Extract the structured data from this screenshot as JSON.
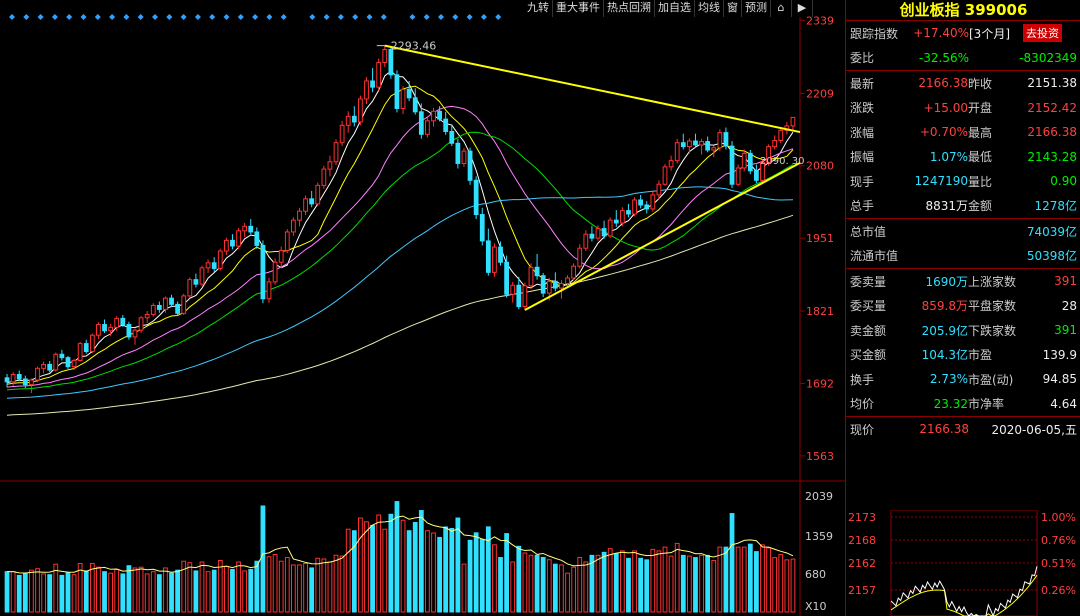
{
  "toolbar": [
    "九转",
    "重大事件",
    "热点回溯",
    "加自选",
    "均线",
    "窗",
    "预测"
  ],
  "toolbar_icons": [
    "lock-icon",
    "arrow-right-icon"
  ],
  "chart_data": {
    "type": "candlestick",
    "ohlc": [
      [
        1702,
        1709,
        1685,
        1695
      ],
      [
        1695,
        1712,
        1688,
        1708
      ],
      [
        1708,
        1715,
        1696,
        1700
      ],
      [
        1700,
        1706,
        1684,
        1690
      ],
      [
        1690,
        1701,
        1675,
        1698
      ],
      [
        1698,
        1722,
        1694,
        1719
      ],
      [
        1719,
        1731,
        1710,
        1726
      ],
      [
        1726,
        1732,
        1712,
        1716
      ],
      [
        1716,
        1747,
        1713,
        1744
      ],
      [
        1744,
        1752,
        1733,
        1738
      ],
      [
        1738,
        1741,
        1718,
        1722
      ],
      [
        1722,
        1736,
        1716,
        1733
      ],
      [
        1733,
        1766,
        1731,
        1763
      ],
      [
        1763,
        1770,
        1745,
        1749
      ],
      [
        1749,
        1781,
        1746,
        1778
      ],
      [
        1778,
        1801,
        1771,
        1797
      ],
      [
        1797,
        1806,
        1782,
        1786
      ],
      [
        1786,
        1798,
        1776,
        1792
      ],
      [
        1792,
        1812,
        1785,
        1808
      ],
      [
        1808,
        1814,
        1793,
        1797
      ],
      [
        1797,
        1802,
        1770,
        1775
      ],
      [
        1775,
        1790,
        1761,
        1787
      ],
      [
        1787,
        1812,
        1782,
        1809
      ],
      [
        1809,
        1821,
        1800,
        1815
      ],
      [
        1815,
        1835,
        1811,
        1831
      ],
      [
        1831,
        1838,
        1818,
        1824
      ],
      [
        1824,
        1847,
        1818,
        1844
      ],
      [
        1844,
        1850,
        1828,
        1833
      ],
      [
        1833,
        1838,
        1812,
        1817
      ],
      [
        1817,
        1852,
        1814,
        1848
      ],
      [
        1848,
        1881,
        1845,
        1877
      ],
      [
        1877,
        1888,
        1863,
        1869
      ],
      [
        1869,
        1902,
        1865,
        1898
      ],
      [
        1898,
        1913,
        1889,
        1907
      ],
      [
        1907,
        1917,
        1891,
        1897
      ],
      [
        1897,
        1932,
        1893,
        1928
      ],
      [
        1928,
        1952,
        1921,
        1947
      ],
      [
        1947,
        1958,
        1931,
        1937
      ],
      [
        1937,
        1969,
        1932,
        1964
      ],
      [
        1964,
        1978,
        1953,
        1972
      ],
      [
        1972,
        1985,
        1958,
        1962
      ],
      [
        1962,
        1970,
        1932,
        1938
      ],
      [
        1938,
        1947,
        1835,
        1843
      ],
      [
        1843,
        1880,
        1836,
        1873
      ],
      [
        1873,
        1915,
        1868,
        1908
      ],
      [
        1908,
        1936,
        1898,
        1929
      ],
      [
        1929,
        1967,
        1924,
        1962
      ],
      [
        1962,
        1988,
        1955,
        1983
      ],
      [
        1983,
        2005,
        1972,
        1999
      ],
      [
        1999,
        2027,
        1992,
        2021
      ],
      [
        2021,
        2035,
        2006,
        2012
      ],
      [
        2012,
        2050,
        2008,
        2045
      ],
      [
        2045,
        2080,
        2039,
        2074
      ],
      [
        2074,
        2098,
        2061,
        2087
      ],
      [
        2087,
        2127,
        2081,
        2121
      ],
      [
        2121,
        2160,
        2115,
        2152
      ],
      [
        2152,
        2177,
        2139,
        2168
      ],
      [
        2168,
        2186,
        2150,
        2158
      ],
      [
        2158,
        2205,
        2152,
        2199
      ],
      [
        2199,
        2238,
        2190,
        2231
      ],
      [
        2231,
        2254,
        2211,
        2220
      ],
      [
        2220,
        2271,
        2214,
        2264
      ],
      [
        2264,
        2294,
        2256,
        2287
      ],
      [
        2287,
        2293,
        2235,
        2242
      ],
      [
        2242,
        2250,
        2175,
        2182
      ],
      [
        2182,
        2222,
        2172,
        2216
      ],
      [
        2216,
        2231,
        2195,
        2201
      ],
      [
        2201,
        2218,
        2171,
        2176
      ],
      [
        2176,
        2191,
        2128,
        2136
      ],
      [
        2136,
        2166,
        2130,
        2160
      ],
      [
        2160,
        2183,
        2150,
        2177
      ],
      [
        2177,
        2186,
        2159,
        2163
      ],
      [
        2163,
        2176,
        2135,
        2141
      ],
      [
        2141,
        2154,
        2115,
        2120
      ],
      [
        2120,
        2128,
        2075,
        2084
      ],
      [
        2084,
        2112,
        2078,
        2106
      ],
      [
        2106,
        2112,
        2046,
        2054
      ],
      [
        2054,
        2061,
        1985,
        1993
      ],
      [
        1993,
        2005,
        1938,
        1946
      ],
      [
        1946,
        1968,
        1884,
        1890
      ],
      [
        1890,
        1942,
        1882,
        1935
      ],
      [
        1935,
        1945,
        1902,
        1908
      ],
      [
        1908,
        1920,
        1845,
        1851
      ],
      [
        1851,
        1873,
        1836,
        1867
      ],
      [
        1867,
        1882,
        1824,
        1829
      ],
      [
        1829,
        1872,
        1823,
        1866
      ],
      [
        1866,
        1906,
        1860,
        1899
      ],
      [
        1899,
        1923,
        1877,
        1884
      ],
      [
        1884,
        1889,
        1846,
        1853
      ],
      [
        1853,
        1880,
        1840,
        1874
      ],
      [
        1874,
        1890,
        1856,
        1862
      ],
      [
        1862,
        1876,
        1843,
        1870
      ],
      [
        1870,
        1885,
        1863,
        1880
      ],
      [
        1880,
        1906,
        1876,
        1901
      ],
      [
        1901,
        1940,
        1897,
        1933
      ],
      [
        1933,
        1965,
        1928,
        1958
      ],
      [
        1958,
        1973,
        1945,
        1951
      ],
      [
        1951,
        1974,
        1946,
        1968
      ],
      [
        1968,
        1982,
        1950,
        1955
      ],
      [
        1955,
        1988,
        1951,
        1983
      ],
      [
        1983,
        2001,
        1971,
        1978
      ],
      [
        1978,
        2006,
        1972,
        2000
      ],
      [
        2000,
        2012,
        1988,
        1994
      ],
      [
        1994,
        2024,
        1990,
        2019
      ],
      [
        2019,
        2028,
        2004,
        2010
      ],
      [
        2010,
        2017,
        1995,
        2003
      ],
      [
        2003,
        2034,
        1998,
        2028
      ],
      [
        2028,
        2054,
        2020,
        2047
      ],
      [
        2047,
        2083,
        2044,
        2078
      ],
      [
        2078,
        2098,
        2071,
        2089
      ],
      [
        2089,
        2128,
        2084,
        2121
      ],
      [
        2121,
        2137,
        2109,
        2114
      ],
      [
        2114,
        2129,
        2102,
        2124
      ],
      [
        2124,
        2137,
        2112,
        2117
      ],
      [
        2117,
        2128,
        2100,
        2123
      ],
      [
        2123,
        2132,
        2104,
        2108
      ],
      [
        2108,
        2116,
        2095,
        2112
      ],
      [
        2112,
        2145,
        2106,
        2139
      ],
      [
        2139,
        2148,
        2109,
        2115
      ],
      [
        2115,
        2124,
        2040,
        2047
      ],
      [
        2047,
        2082,
        2043,
        2076
      ],
      [
        2076,
        2109,
        2070,
        2102
      ],
      [
        2102,
        2108,
        2065,
        2071
      ],
      [
        2071,
        2082,
        2049,
        2054
      ],
      [
        2054,
        2091,
        2049,
        2086
      ],
      [
        2086,
        2118,
        2080,
        2114
      ],
      [
        2114,
        2134,
        2109,
        2125
      ],
      [
        2125,
        2149,
        2120,
        2143
      ],
      [
        2143,
        2158,
        2136,
        2151
      ],
      [
        2151,
        2166,
        2143,
        2166
      ]
    ],
    "volume": [],
    "ma_periods": [
      5,
      10,
      20,
      30,
      60,
      120
    ],
    "ma_colors": [
      "#ffffff",
      "#ffff00",
      "#ff80ff",
      "#00dd00",
      "#40c8ff",
      "#e6e6b0"
    ],
    "y_ticks": [
      "2339",
      "2209",
      "2080",
      "1951",
      "1821",
      "1692",
      "1563"
    ],
    "vol_ticks": [
      "2039",
      "1359",
      "680",
      "X10"
    ],
    "high_label": "2293.46",
    "line_label": "2090. 30",
    "ylim": [
      1520,
      2345
    ]
  },
  "panel": {
    "title": "创业板指 399006",
    "rows": [
      [
        {
          "t": "跟踪指数",
          "c": "lbl"
        },
        {
          "t": "+17.40%",
          "c": "r"
        },
        {
          "t": "[3个月]",
          "c": "w"
        },
        {
          "btn": "去投资"
        }
      ],
      [
        {
          "t": "委比",
          "c": "lbl"
        },
        {
          "t": "-32.56%",
          "c": "g"
        },
        {
          "t": "-8302349",
          "c": "g"
        }
      ],
      [
        {
          "t": "最新",
          "c": "lbl"
        },
        {
          "t": "2166.38",
          "c": "r"
        },
        {
          "t": "昨收",
          "c": "lbl"
        },
        {
          "t": "2151.38",
          "c": "w"
        }
      ],
      [
        {
          "t": "涨跌",
          "c": "lbl"
        },
        {
          "t": "+15.00",
          "c": "r"
        },
        {
          "t": "开盘",
          "c": "lbl"
        },
        {
          "t": "2152.42",
          "c": "r"
        }
      ],
      [
        {
          "t": "涨幅",
          "c": "lbl"
        },
        {
          "t": "+0.70%",
          "c": "r"
        },
        {
          "t": "最高",
          "c": "lbl"
        },
        {
          "t": "2166.38",
          "c": "r"
        }
      ],
      [
        {
          "t": "振幅",
          "c": "lbl"
        },
        {
          "t": "1.07%",
          "c": "c"
        },
        {
          "t": "最低",
          "c": "lbl"
        },
        {
          "t": "2143.28",
          "c": "g"
        }
      ],
      [
        {
          "t": "现手",
          "c": "lbl"
        },
        {
          "t": "1247190",
          "c": "c"
        },
        {
          "t": "量比",
          "c": "lbl"
        },
        {
          "t": "0.90",
          "c": "g"
        }
      ],
      [
        {
          "t": "总手",
          "c": "lbl"
        },
        {
          "t": "8831万",
          "c": "w"
        },
        {
          "t": "金额",
          "c": "lbl"
        },
        {
          "t": "1278亿",
          "c": "c"
        }
      ],
      [
        {
          "t": "总市值",
          "c": "lbl"
        },
        {
          "t": "74039亿",
          "c": "c"
        }
      ],
      [
        {
          "t": "流通市值",
          "c": "lbl"
        },
        {
          "t": "50398亿",
          "c": "c"
        }
      ],
      [
        {
          "t": "委卖量",
          "c": "lbl"
        },
        {
          "t": "1690万",
          "c": "c"
        },
        {
          "t": "上涨家数",
          "c": "lbl"
        },
        {
          "t": "391",
          "c": "r"
        }
      ],
      [
        {
          "t": "委买量",
          "c": "lbl"
        },
        {
          "t": "859.8万",
          "c": "r"
        },
        {
          "t": "平盘家数",
          "c": "lbl"
        },
        {
          "t": "28",
          "c": "w"
        }
      ],
      [
        {
          "t": "卖金额",
          "c": "lbl"
        },
        {
          "t": "205.9亿",
          "c": "c"
        },
        {
          "t": "下跌家数",
          "c": "lbl"
        },
        {
          "t": "391",
          "c": "g"
        }
      ],
      [
        {
          "t": "买金额",
          "c": "lbl"
        },
        {
          "t": "104.3亿",
          "c": "c"
        },
        {
          "t": "市盈",
          "c": "lbl"
        },
        {
          "t": "139.9",
          "c": "w"
        }
      ],
      [
        {
          "t": "换手",
          "c": "lbl"
        },
        {
          "t": "2.73%",
          "c": "c"
        },
        {
          "t": "市盈(动)",
          "c": "lbl"
        },
        {
          "t": "94.85",
          "c": "w"
        }
      ],
      [
        {
          "t": "均价",
          "c": "lbl"
        },
        {
          "t": "23.32",
          "c": "g"
        },
        {
          "t": "市净率",
          "c": "lbl"
        },
        {
          "t": "4.64",
          "c": "w"
        }
      ],
      [
        {
          "t": "现价",
          "c": "lbl"
        },
        {
          "t": "2166.38",
          "c": "r"
        },
        {
          "t": "2020-06-05,五",
          "c": "w"
        }
      ]
    ],
    "separators_after": [
      1,
      7,
      9,
      15
    ]
  },
  "intraday": {
    "left_ticks": [
      "2173",
      "2168",
      "2162",
      "2157"
    ],
    "right_ticks": [
      "1.00%",
      "0.76%",
      "0.51%",
      "0.26%"
    ]
  }
}
